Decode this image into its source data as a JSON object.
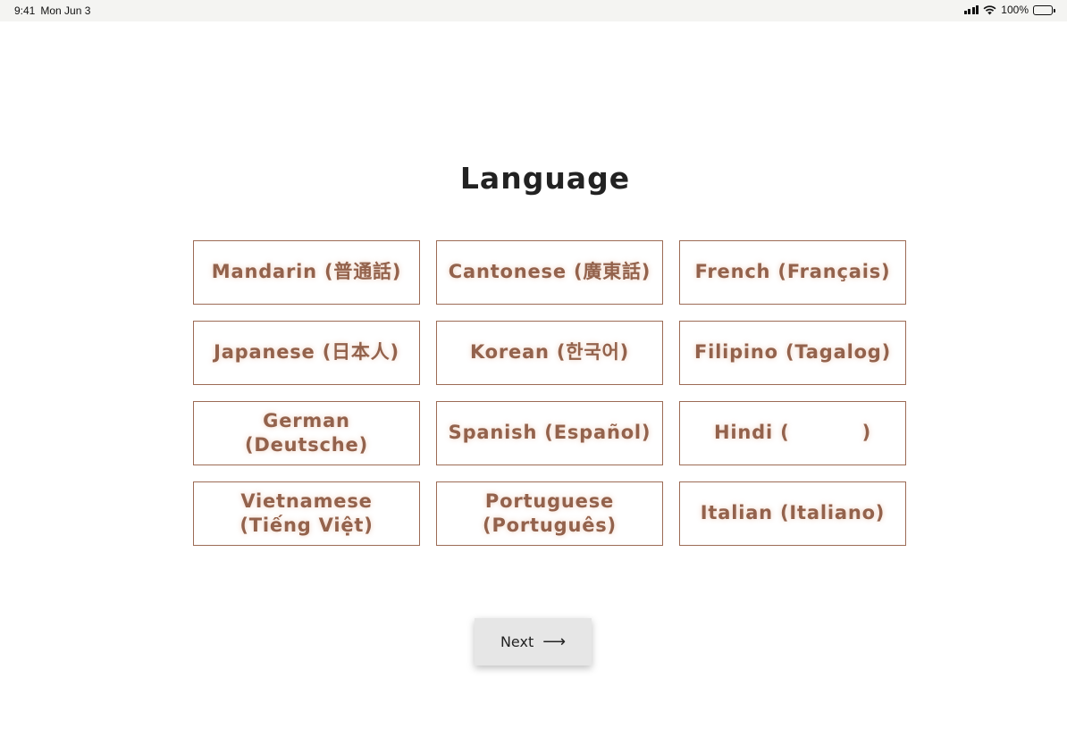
{
  "status_bar": {
    "time": "9:41",
    "date": "Mon Jun 3",
    "battery": "100%"
  },
  "page": {
    "title": "Language"
  },
  "languages": [
    "Mandarin (普通話)",
    "Cantonese (廣東話)",
    "French (Français)",
    "Japanese (日本人)",
    "Korean (한국어)",
    "Filipino (Tagalog)",
    "German (Deutsche)",
    "Spanish (Español)",
    "Hindi (          )",
    "Vietnamese (Tiếng Việt)",
    "Portuguese (Português)",
    "Italian (Italiano)"
  ],
  "next_button": {
    "label": "Next",
    "arrow": "⟶"
  }
}
